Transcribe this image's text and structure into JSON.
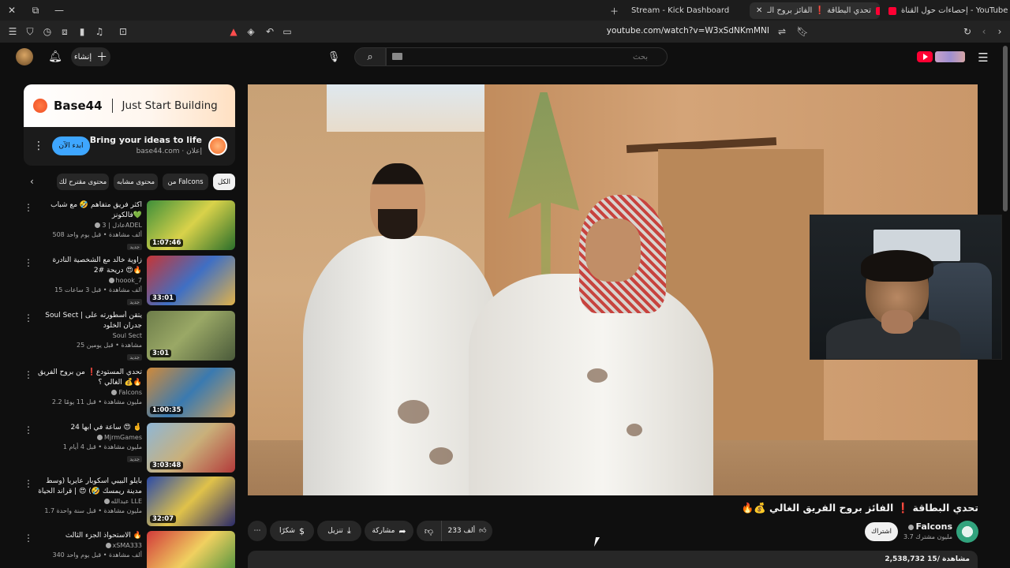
{
  "browser": {
    "tabs": [
      {
        "label": "إحصاءات حول القناة - YouTube Studio",
        "active": false
      },
      {
        "label": "تحدي البطاقة ❗ الفائز بروح الـ",
        "active": true
      },
      {
        "label": "Stream - Kick Dashboard",
        "active": false
      }
    ],
    "url": "youtube.com/watch?v=W3xSdNKmMNI"
  },
  "header": {
    "create_label": "إنشاء",
    "search_placeholder": "بحث"
  },
  "ad": {
    "brand": "Base44",
    "tagline": "Just Start Building",
    "title": "Bring your ideas to life",
    "domain": "base44.com · إعلان",
    "cta": "ابدء الآن"
  },
  "chips": [
    "الكل",
    "من Falcons",
    "محتوى مشابه",
    "محتوى مقترح لك"
  ],
  "recommendations": [
    {
      "title": "اكثر فريق متفاهم 🤣 مع شباب فالكونز💚",
      "channel": "عادل | 3ADEL",
      "meta": "508 ألف مشاهدة • قبل يوم واحد",
      "badge": "جديد",
      "duration": "1:07:46"
    },
    {
      "title": "زاوية خالد مع الشخصية النادرة دريحة #2 😍🔥",
      "channel": "hoook_7",
      "meta": "15 ألف مشاهدة • قبل 3 ساعات",
      "badge": "جديد",
      "duration": "33:01"
    },
    {
      "title": "Soul Sect | يتقن أسطورته على جدران الخلود",
      "channel": "Soul Sect",
      "meta": "25 مشاهدة • قبل يومين",
      "badge": "جديد",
      "duration": "3:01"
    },
    {
      "title": "تحدي المستودع❗ من بروح الفريق الغالي ؟ 💰🔥",
      "channel": "Falcons",
      "meta": "2.2 مليون مشاهدة • قبل 11 يومًا",
      "badge": "",
      "duration": "1:00:35"
    },
    {
      "title": "24 ساعة في ابها 😍 🤞",
      "channel": "MjrmGames",
      "meta": "1 مليون مشاهدة • قبل 4 أيام",
      "badge": "جديد",
      "duration": "3:03:48"
    },
    {
      "title": "بايلو البيبي اسكوبار عايريا (وسط مدينة ريمسك 🤣) 😍 | قراند الحياة الواقعية",
      "channel": "عبدالله LLE",
      "meta": "1.7 مليون مشاهدة • قبل سنة واحدة",
      "badge": "",
      "duration": "32:07"
    },
    {
      "title": "الاستحواذ الجزء الثالث 🔥",
      "channel": "xSMA333",
      "meta": "340 ألف مشاهدة • قبل يوم واحد",
      "badge": "جديد",
      "duration": ""
    }
  ],
  "video": {
    "title": "تحدي البطاقة ❗ الفائز بروح الفريق الغالي 💰🔥",
    "channel": "Falcons",
    "subscribers": "3.7 مليون مشترك",
    "subscribe_label": "اشتراك",
    "likes": "233 ألف",
    "share_label": "مشاركة",
    "download_label": "تنزيل",
    "thanks_label": "شكرًا",
    "more": "⋯",
    "description_stats": "2,538,732 مشاهدة  /15"
  },
  "colors": {
    "background": "#0f0f0f",
    "chip": "#272727",
    "accent_blue": "#3ea6ff",
    "yt_red": "#ff0033"
  }
}
